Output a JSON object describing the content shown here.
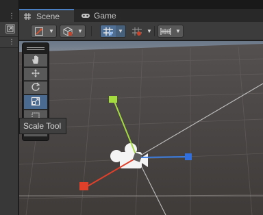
{
  "tabs": [
    {
      "label": "Scene",
      "active": true,
      "icon": "grid-icon"
    },
    {
      "label": "Game",
      "active": false,
      "icon": "gamepad-icon"
    }
  ],
  "toolbar": {
    "groups": [
      {
        "name": "draw-mode-dropdown",
        "icon": "draw-mode-icon"
      },
      {
        "name": "shading-dropdown",
        "icon": "cube-icon"
      },
      {
        "name": "grid-snap-dropdown",
        "icon": "grid-snap-icon",
        "active": true
      },
      {
        "name": "increment-snap-dropdown",
        "icon": "increment-snap-icon"
      },
      {
        "name": "snap-settings-dropdown",
        "icon": "ruler-icon"
      }
    ]
  },
  "tools": [
    {
      "name": "view-tool",
      "icon": "hand-icon"
    },
    {
      "name": "move-tool",
      "icon": "move-arrows-icon"
    },
    {
      "name": "rotate-tool",
      "icon": "rotate-icon"
    },
    {
      "name": "scale-tool",
      "icon": "scale-icon",
      "selected": true
    },
    {
      "name": "rect-tool",
      "icon": "rect-icon"
    },
    {
      "name": "transform-tool",
      "icon": "transform-icon"
    }
  ],
  "tooltip": {
    "text": "Scale Tool"
  },
  "colors": {
    "accent": "#4a7fc4",
    "x_axis": "#e0402a",
    "y_axis": "#9cd43a",
    "z_axis": "#3a7fe6",
    "ground": "#4a4542",
    "sky": "#6d7b8c"
  }
}
